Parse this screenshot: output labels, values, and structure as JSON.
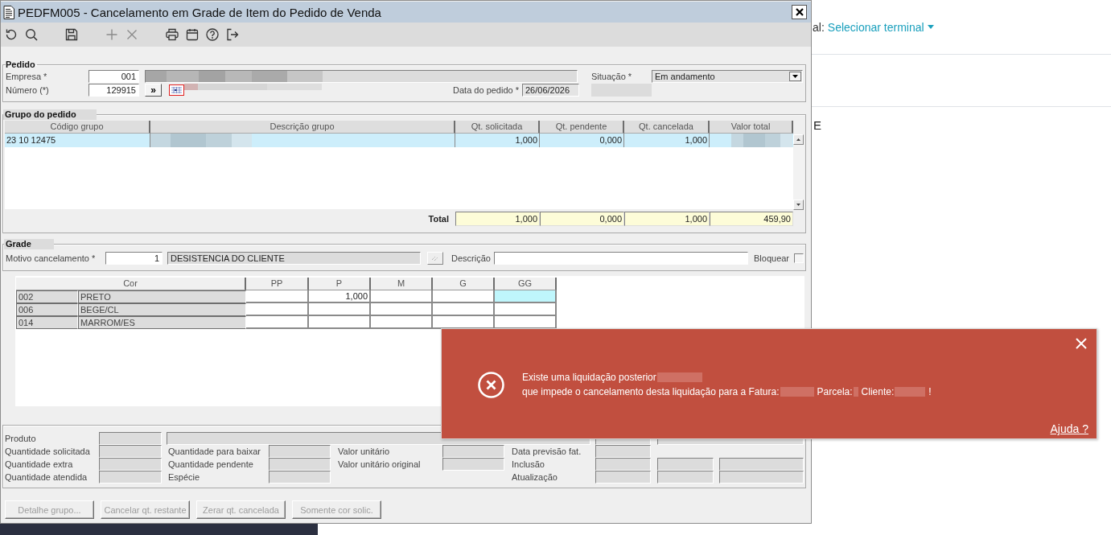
{
  "window": {
    "title": "PEDFM005 - Cancelamento em Grade de Item do Pedido de Venda"
  },
  "toolbar": [
    [
      {
        "kind": "refresh",
        "disabled": false
      },
      {
        "kind": "search",
        "disabled": false
      }
    ],
    [
      {
        "kind": "save",
        "disabled": false
      }
    ],
    [
      {
        "kind": "add",
        "disabled": true
      },
      {
        "kind": "remove",
        "disabled": true
      }
    ],
    [
      {
        "kind": "print",
        "disabled": false
      },
      {
        "kind": "calendar",
        "disabled": false
      },
      {
        "kind": "help",
        "disabled": false
      },
      {
        "kind": "exit",
        "disabled": false
      }
    ]
  ],
  "pedido": {
    "title": "Pedido",
    "empresa": {
      "label": "Empresa *",
      "value": "001"
    },
    "numero": {
      "label": "Número (*)",
      "value": "129915"
    },
    "next_button": "»",
    "situacao": {
      "label": "Situação *",
      "value": "Em andamento"
    },
    "data_pedido": {
      "label": "Data do pedido *",
      "value": "26/06/2026"
    }
  },
  "grupo_pedido": {
    "title": "Grupo do pedido",
    "columns": [
      "Código grupo",
      "Descrição grupo",
      "Qt. solicitada",
      "Qt. pendente",
      "Qt. cancelada",
      "Valor total"
    ],
    "rows": [
      {
        "codigo": "23 10 12475",
        "qt_solicitada": "1,000",
        "qt_pendente": "0,000",
        "qt_cancelada": "1,000",
        "selected": true
      }
    ],
    "total": {
      "label": "Total",
      "values": [
        "1,000",
        "0,000",
        "1,000",
        "459,90"
      ]
    }
  },
  "grade": {
    "title": "Grade",
    "motivo": {
      "label": "Motivo cancelamento *",
      "code": "1",
      "description": "DESISTENCIA DO CLIENTE"
    },
    "descricao": {
      "label": "Descrição"
    },
    "bloquear": {
      "label": "Bloquear",
      "checked": false
    },
    "grid": {
      "columns": [
        "Cor",
        "PP",
        "P",
        "M",
        "G",
        "GG"
      ],
      "rows": [
        {
          "code": "002",
          "name": "PRETO",
          "cells": [
            {
              "selected": false
            },
            {
              "value": "1,000",
              "selected": false
            },
            {
              "selected": false
            },
            {
              "selected": false
            },
            {
              "selected": true
            }
          ]
        },
        {
          "code": "006",
          "name": "BEGE/CL",
          "cells": [
            {
              "selected": false
            },
            {
              "selected": false
            },
            {
              "selected": false
            },
            {
              "selected": false
            },
            {
              "selected": false
            }
          ]
        },
        {
          "code": "014",
          "name": "MARROM/ES",
          "cells": [
            {
              "selected": false
            },
            {
              "selected": false
            },
            {
              "selected": false
            },
            {
              "selected": false
            },
            {
              "selected": false
            }
          ]
        }
      ]
    }
  },
  "detalhes": {
    "produto": {
      "label": "Produto"
    },
    "columns": [
      [
        {
          "label": "Quantidade solicitada",
          "kind": "single"
        },
        {
          "label": "Quantidade extra",
          "kind": "single"
        },
        {
          "label": "Quantidade atendida",
          "kind": "single"
        }
      ],
      [
        {
          "label": "Quantidade para baixar",
          "kind": "single"
        },
        {
          "label": "Quantidade pendente",
          "kind": "single"
        },
        {
          "label": "Espécie",
          "kind": "single"
        }
      ],
      [
        {
          "label": "Valor unitário",
          "kind": "single"
        },
        {
          "label": "Valor unitário original",
          "kind": "single"
        }
      ],
      [
        {
          "label": "Data previsão fat.",
          "kind": "single"
        },
        {
          "label": "Inclusão",
          "kind": "triple"
        },
        {
          "label": "Atualização",
          "kind": "triple"
        }
      ]
    ]
  },
  "buttons": [
    {
      "label": "Detalhe grupo...",
      "disabled": true
    },
    {
      "label": "Cancelar qt. restante",
      "disabled": true
    },
    {
      "label": "Zerar qt. cancelada",
      "disabled": true
    },
    {
      "label": "Somente cor solic.",
      "disabled": true
    }
  ],
  "toast": {
    "lines": [
      [
        {
          "kind": "text",
          "text": "Existe uma liquidação posterior"
        },
        {
          "kind": "blur"
        }
      ],
      [
        {
          "kind": "text",
          "text": "que impede o cancelamento desta liquidação para a Fatura:"
        },
        {
          "kind": "blur"
        },
        {
          "kind": "text",
          "text": "Parcela:"
        },
        {
          "kind": "blur"
        },
        {
          "kind": "text",
          "text": "Cliente:"
        },
        {
          "kind": "blur"
        },
        {
          "kind": "text",
          "text": "!"
        }
      ]
    ],
    "link": "Ajuda ?"
  },
  "page": {
    "terminal": {
      "label": "al:",
      "link": "Selecionar terminal"
    },
    "heading": "E"
  }
}
